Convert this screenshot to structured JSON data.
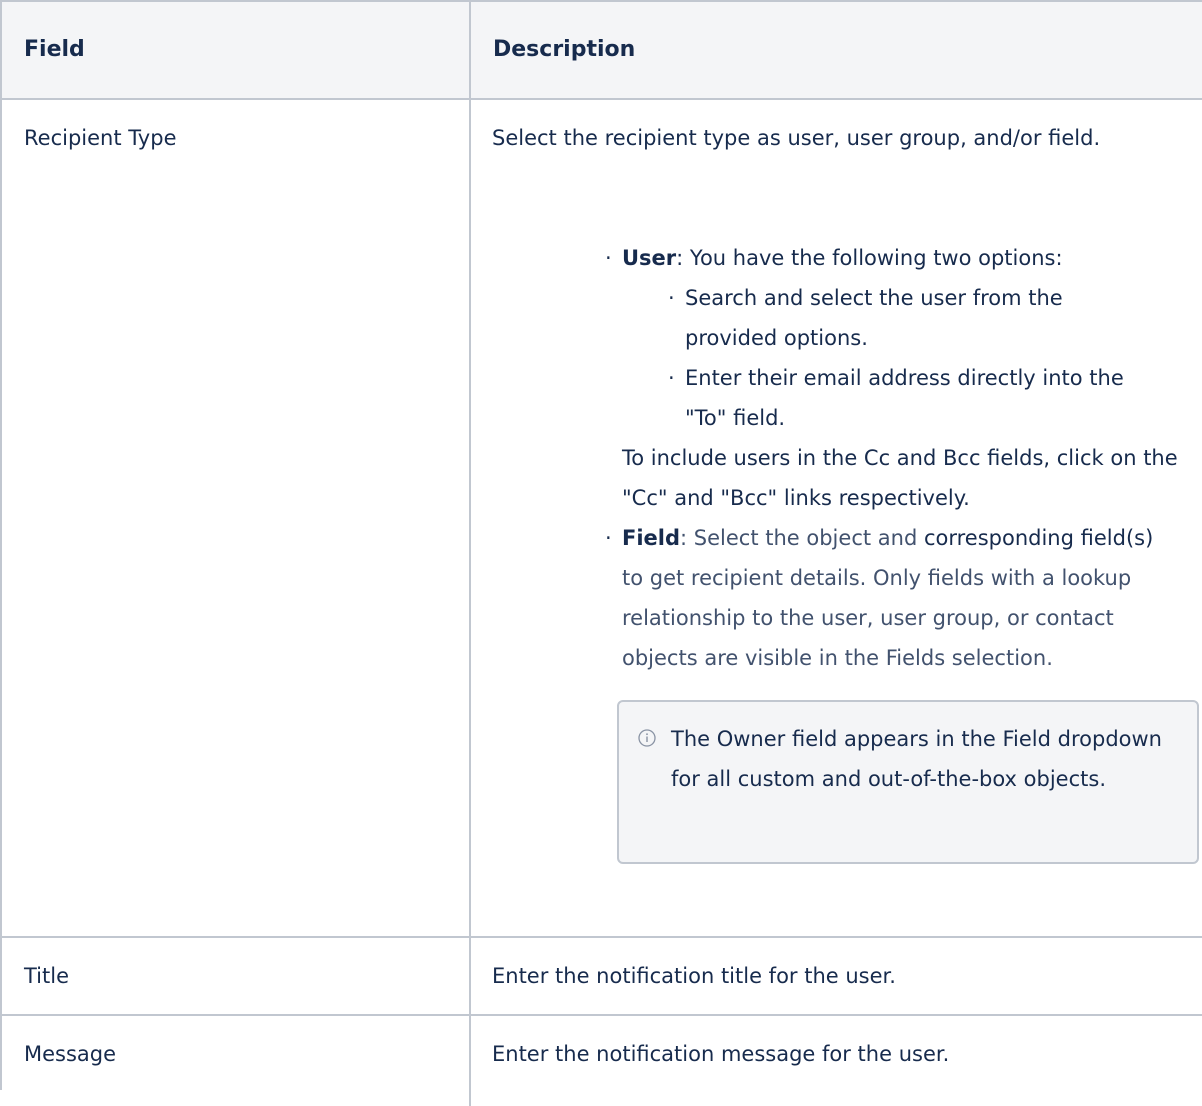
{
  "table": {
    "headers": {
      "field": "Field",
      "description": "Description"
    },
    "rows": [
      {
        "field": "Recipient Type",
        "intro": "Select the recipient type as user, user group, and/or field.",
        "user_bullet": {
          "label": "User",
          "text": ": You have the following two options:"
        },
        "user_options": [
          "Search and select the user from the provided options.",
          "Enter their email address directly into the \"To\" field."
        ],
        "cc_text": "To include users in the Cc and Bcc fields, click on the \"Cc\" and \"Bcc\" links respectively.",
        "field_bullet": {
          "label": "Field",
          "text_a": ": Select the object and",
          "text_b": " corresponding",
          "text_c": "field(s)",
          "text_d": " to get recipient details. Only fields with a lookup relationship to the user, user group, or contact objects are visible in the Fields selection."
        },
        "note": {
          "icon": "info-icon",
          "text": "The Owner field appears in the Field dropdown for all custom and out-of-the-box objects."
        }
      },
      {
        "field": "Title",
        "description": "Enter the notification title for the user."
      },
      {
        "field": "Message",
        "description": "Enter the notification message for the user."
      }
    ]
  }
}
